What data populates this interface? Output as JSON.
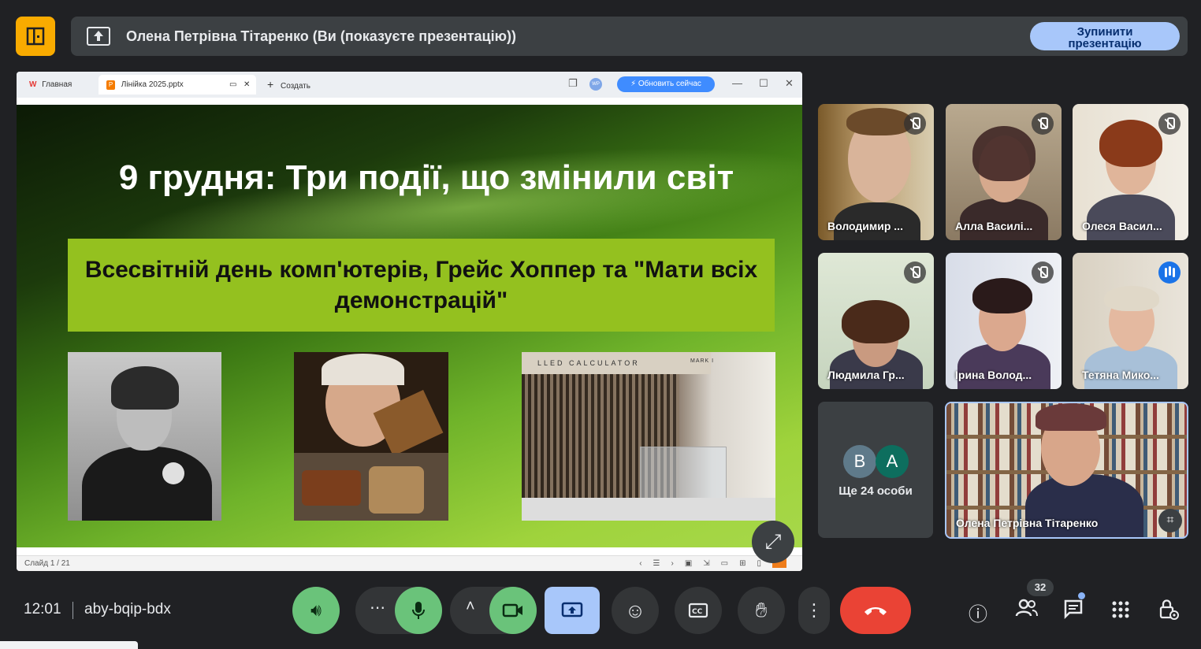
{
  "banner": {
    "text": "Олена Петрівна Тітаренко (Ви (показуєте презентацію))",
    "stop_label_line1": "Зупинити",
    "stop_label_line2": "презентацію"
  },
  "presentation_window": {
    "tabs": [
      {
        "label": "Главная"
      },
      {
        "label": "Лінійка 2025.pptx"
      }
    ],
    "new_tab_label": "Создать",
    "update_label": "Обновить сейчас",
    "wps_badge": "WP",
    "slide": {
      "title": "9 грудня: Три події, що змінили світ",
      "subtitle": "Всесвітній день комп'ютерів, Грейс Хоппер та \"Мати всіх демонстрацій\"",
      "photo3_header": "LLED  CALCULATOR",
      "photo3_marker": "MARK I"
    },
    "status": "Слайд 1 / 21"
  },
  "participants": [
    {
      "name": "Володимир ...",
      "mic": "muted"
    },
    {
      "name": "Алла Василі...",
      "mic": "muted"
    },
    {
      "name": "Олеся Васил...",
      "mic": "muted"
    },
    {
      "name": "Людмила Гр...",
      "mic": "muted"
    },
    {
      "name": "Ірина Волод...",
      "mic": "muted"
    },
    {
      "name": "Тетяна Мико...",
      "mic": "speaking"
    }
  ],
  "more_tile": {
    "avatars": [
      {
        "letter": "В",
        "color": "#5f7a8a"
      },
      {
        "letter": "А",
        "color": "#0d6e5e"
      }
    ],
    "text": "Ще 24 особи"
  },
  "self_tile": {
    "name": "Олена Петрівна Тітаренко"
  },
  "bottom_bar": {
    "time": "12:01",
    "meeting_code": "aby-bqip-bdx",
    "people_count": "32"
  },
  "colors": {
    "background": "#202124",
    "accent_blue": "#a8c7fa",
    "green_button": "#6ac37a",
    "end_call_red": "#ea4335",
    "slide_green_box": "#94c11f"
  }
}
